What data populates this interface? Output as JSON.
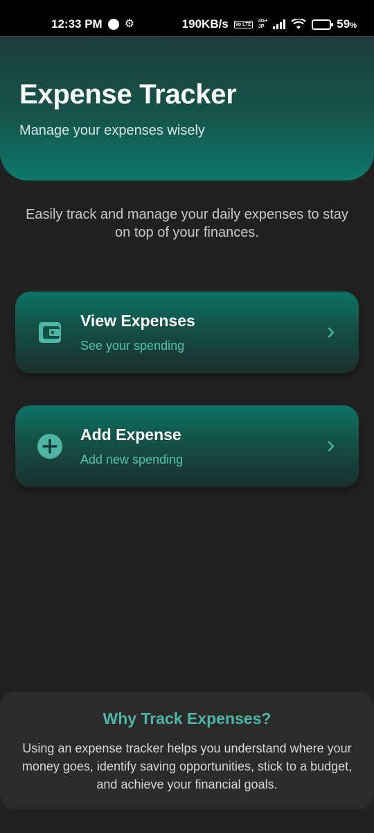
{
  "status_bar": {
    "time": "12:33 PM",
    "speed": "190KB/s",
    "network_top": "4G+",
    "network_bottom": "JP",
    "volte": "Vo LTE",
    "battery_percent": "59",
    "battery_sign": "%",
    "battery_level": 0.59
  },
  "header": {
    "title": "Expense Tracker",
    "subtitle": "Manage your expenses wisely"
  },
  "intro": "Easily track and manage your daily expenses to stay on top of your finances.",
  "cards": [
    {
      "title": "View Expenses",
      "subtitle": "See your spending",
      "icon": "wallet-icon"
    },
    {
      "title": "Add Expense",
      "subtitle": "Add new spending",
      "icon": "plus-circle-icon"
    }
  ],
  "why": {
    "title": "Why Track Expenses?",
    "body": "Using an expense tracker helps you understand where your money goes, identify saving opportunities, stick to a budget, and achieve your financial goals."
  },
  "colors": {
    "accent": "#4db6a4",
    "background": "#212121",
    "card_top": "#0b7465"
  }
}
